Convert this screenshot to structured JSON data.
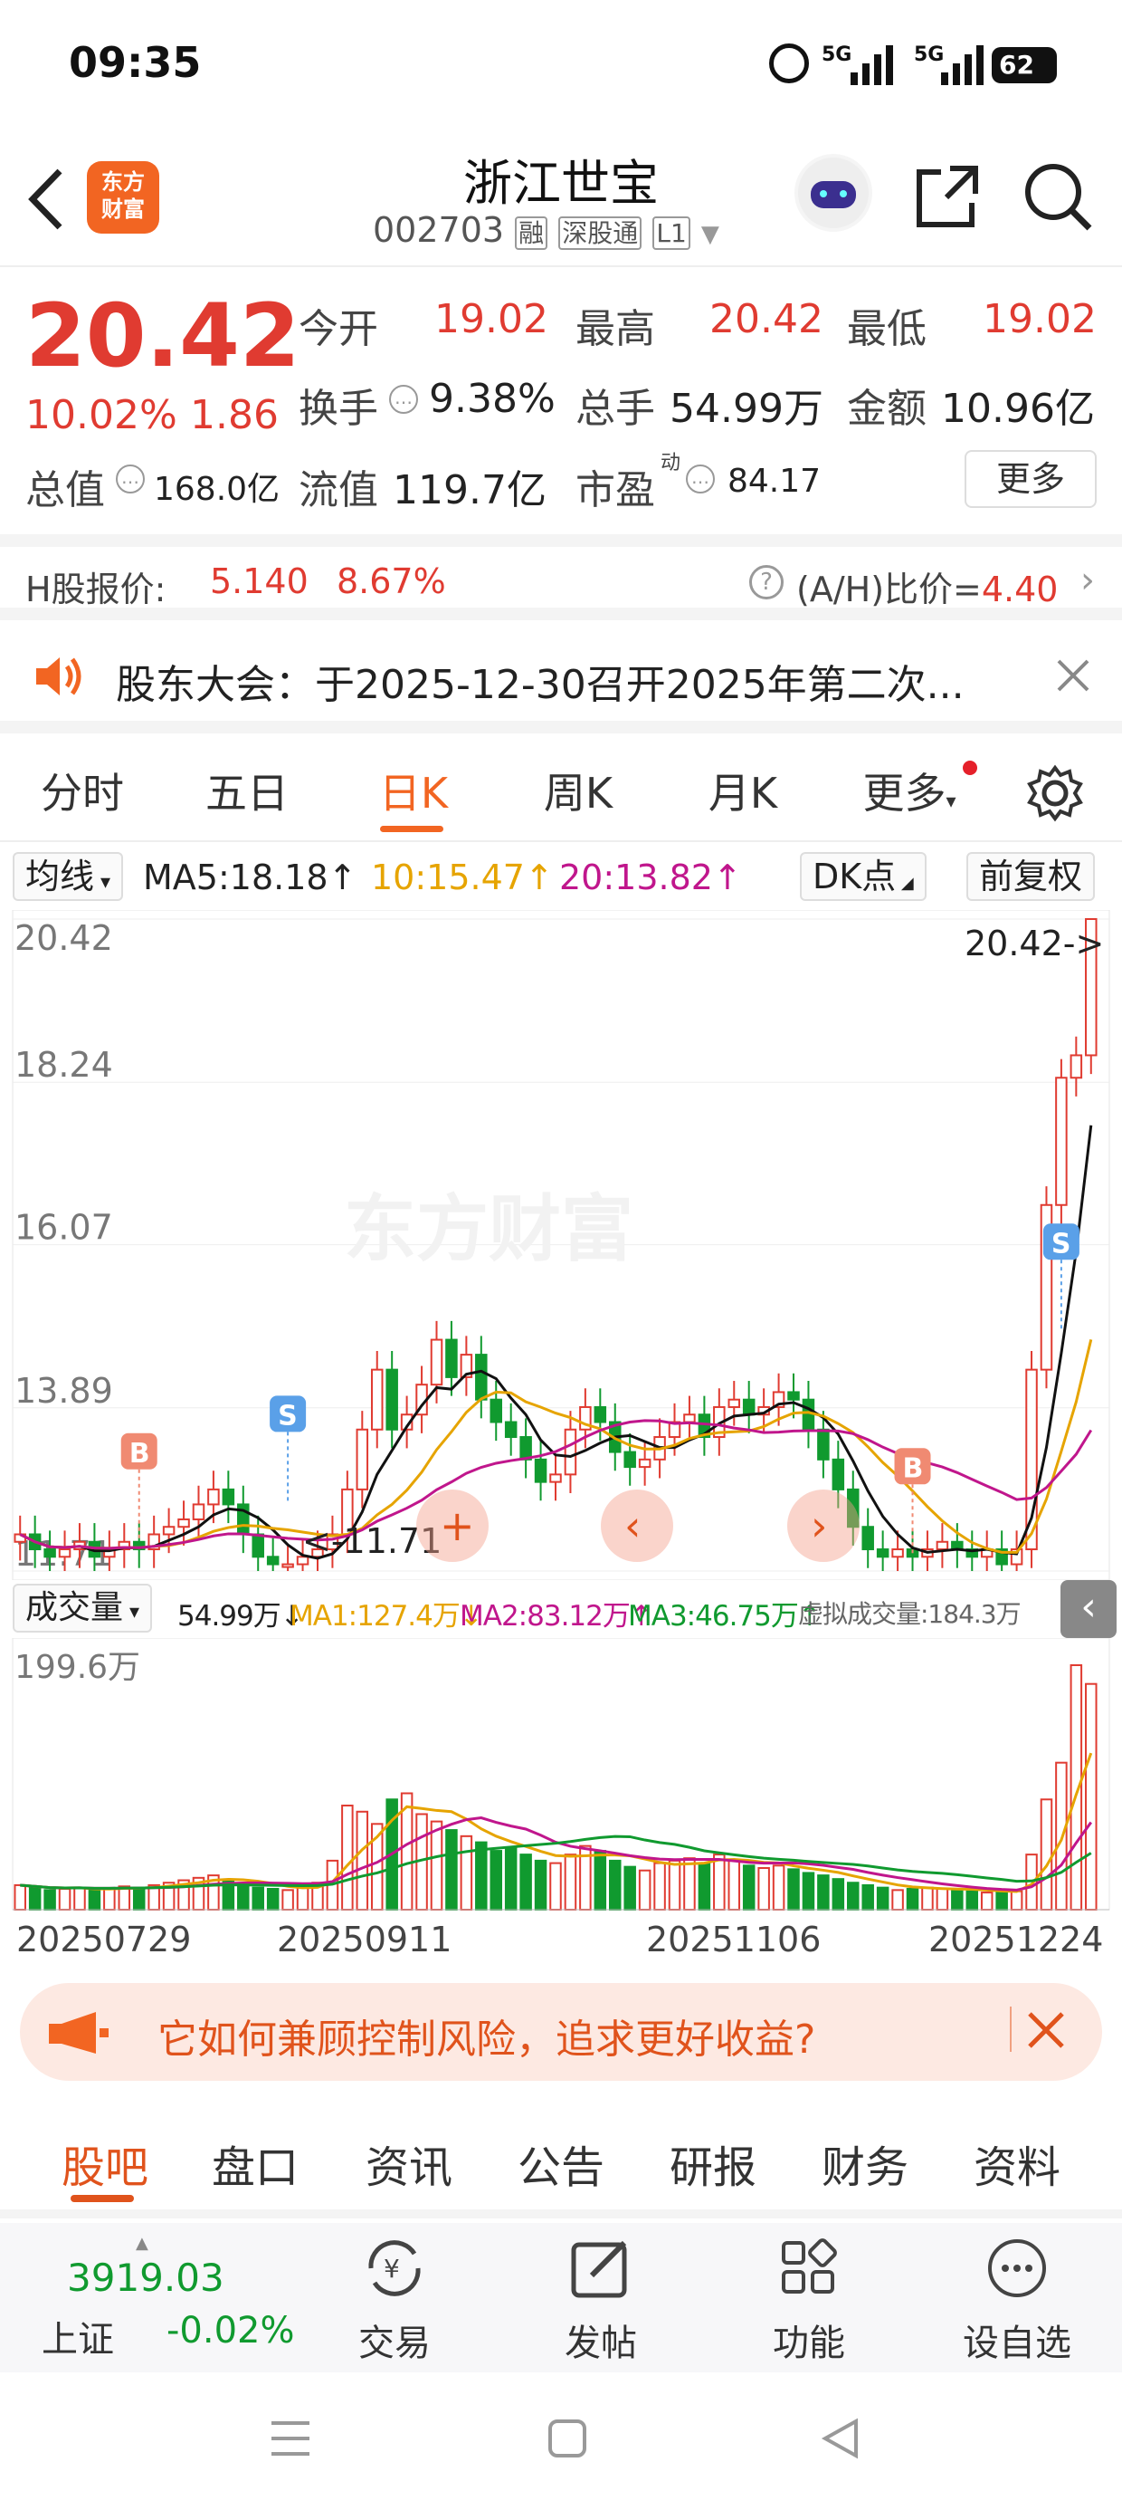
{
  "status": {
    "time": "09:35",
    "battery": "62",
    "net1": "5G",
    "net2": "5G"
  },
  "header": {
    "name": "浙江世宝",
    "code": "002703",
    "tag_rong": "融",
    "tag_sgt": "深股通",
    "tag_l1": "L1",
    "logo_line1": "东方",
    "logo_line2": "财富"
  },
  "quote": {
    "price": "20.42",
    "change_pct": "10.02%",
    "change": "1.86",
    "open_label": "今开",
    "open": "19.02",
    "high_label": "最高",
    "high": "20.42",
    "low_label": "最低",
    "low": "19.02",
    "turnover_label": "换手",
    "turnover": "9.38%",
    "volume_label": "总手",
    "volume": "54.99万",
    "amount_label": "金额",
    "amount": "10.96亿",
    "mktcap_label": "总值",
    "mktcap": "168.0亿",
    "float_label": "流值",
    "float": "119.7亿",
    "pe_label": "市盈",
    "pe_sup": "动",
    "pe": "84.17",
    "more": "更多"
  },
  "hshare": {
    "label": "H股报价:",
    "price": "5.140",
    "pct": "8.67%",
    "ah_label": "(A/H)比价=",
    "ah_value": "4.40"
  },
  "notice": {
    "text": "股东大会：于2025-12-30召开2025年第二次..."
  },
  "tabs": [
    "分时",
    "五日",
    "日K",
    "周K",
    "月K",
    "更多"
  ],
  "active_tab": "日K",
  "chart": {
    "ma_select": "均线",
    "ma5": "MA5:18.18",
    "ma10": "10:15.47",
    "ma20": "20:13.82",
    "dk": "DK点",
    "adjust": "前复权",
    "y_labels": [
      "20.42",
      "18.24",
      "16.07",
      "13.89",
      "11.71"
    ],
    "max_label": "20.42->",
    "min_label": "<-11.71",
    "watermark": "东方财富",
    "marker_b": "B",
    "marker_s": "S"
  },
  "volume": {
    "select": "成交量",
    "vol": "54.99万",
    "ma1": "MA1:127.4万",
    "ma2": "MA2:83.12万",
    "ma3": "MA3:46.75万",
    "virtual": "虚拟成交量:184.3万",
    "y_label": "199.6万",
    "dates": [
      "20250729",
      "20250911",
      "20251106",
      "20251224"
    ]
  },
  "ad": {
    "text": "它如何兼顾控制风险，追求更好收益?"
  },
  "bottom_tabs": [
    "股吧",
    "盘口",
    "资讯",
    "公告",
    "研报",
    "财务",
    "资料"
  ],
  "bottom_nav": {
    "index_value": "3919.03",
    "index_name": "上证",
    "index_pct": "-0.02%",
    "trade": "交易",
    "post": "发帖",
    "func": "功能",
    "watch": "设自选"
  },
  "chart_data": {
    "type": "candlestick",
    "ylim": [
      11.71,
      20.42
    ],
    "closes": [
      12.2,
      12.0,
      11.9,
      12.0,
      12.1,
      11.9,
      12.0,
      12.1,
      12.0,
      12.2,
      12.3,
      12.4,
      12.6,
      12.8,
      12.6,
      12.2,
      11.9,
      11.8,
      11.8,
      11.9,
      12.0,
      12.2,
      12.8,
      13.6,
      14.4,
      13.6,
      13.8,
      14.2,
      14.8,
      14.3,
      14.6,
      14.0,
      13.7,
      13.5,
      13.2,
      12.9,
      13.0,
      13.6,
      13.9,
      13.7,
      13.3,
      13.1,
      13.2,
      13.5,
      13.7,
      13.8,
      13.5,
      13.9,
      14.0,
      13.8,
      13.9,
      14.1,
      14.0,
      13.6,
      13.2,
      12.8,
      12.3,
      12.0,
      11.9,
      12.0,
      11.9,
      12.0,
      12.1,
      12.0,
      11.9,
      12.0,
      11.8,
      12.0,
      14.4,
      16.6,
      18.3,
      18.6,
      20.42
    ],
    "ma5": 18.18,
    "ma10": 15.47,
    "ma20": 13.82,
    "volumes": [
      20,
      18,
      16,
      17,
      18,
      16,
      17,
      19,
      18,
      20,
      22,
      24,
      26,
      28,
      24,
      20,
      18,
      17,
      16,
      18,
      22,
      40,
      85,
      80,
      70,
      90,
      95,
      78,
      72,
      65,
      60,
      55,
      48,
      50,
      45,
      40,
      38,
      45,
      52,
      48,
      40,
      35,
      32,
      38,
      40,
      42,
      38,
      45,
      40,
      36,
      34,
      36,
      33,
      30,
      28,
      25,
      22,
      20,
      18,
      16,
      17,
      18,
      17,
      16,
      15,
      14,
      14,
      15,
      45,
      90,
      120,
      199.6,
      184.3
    ]
  }
}
